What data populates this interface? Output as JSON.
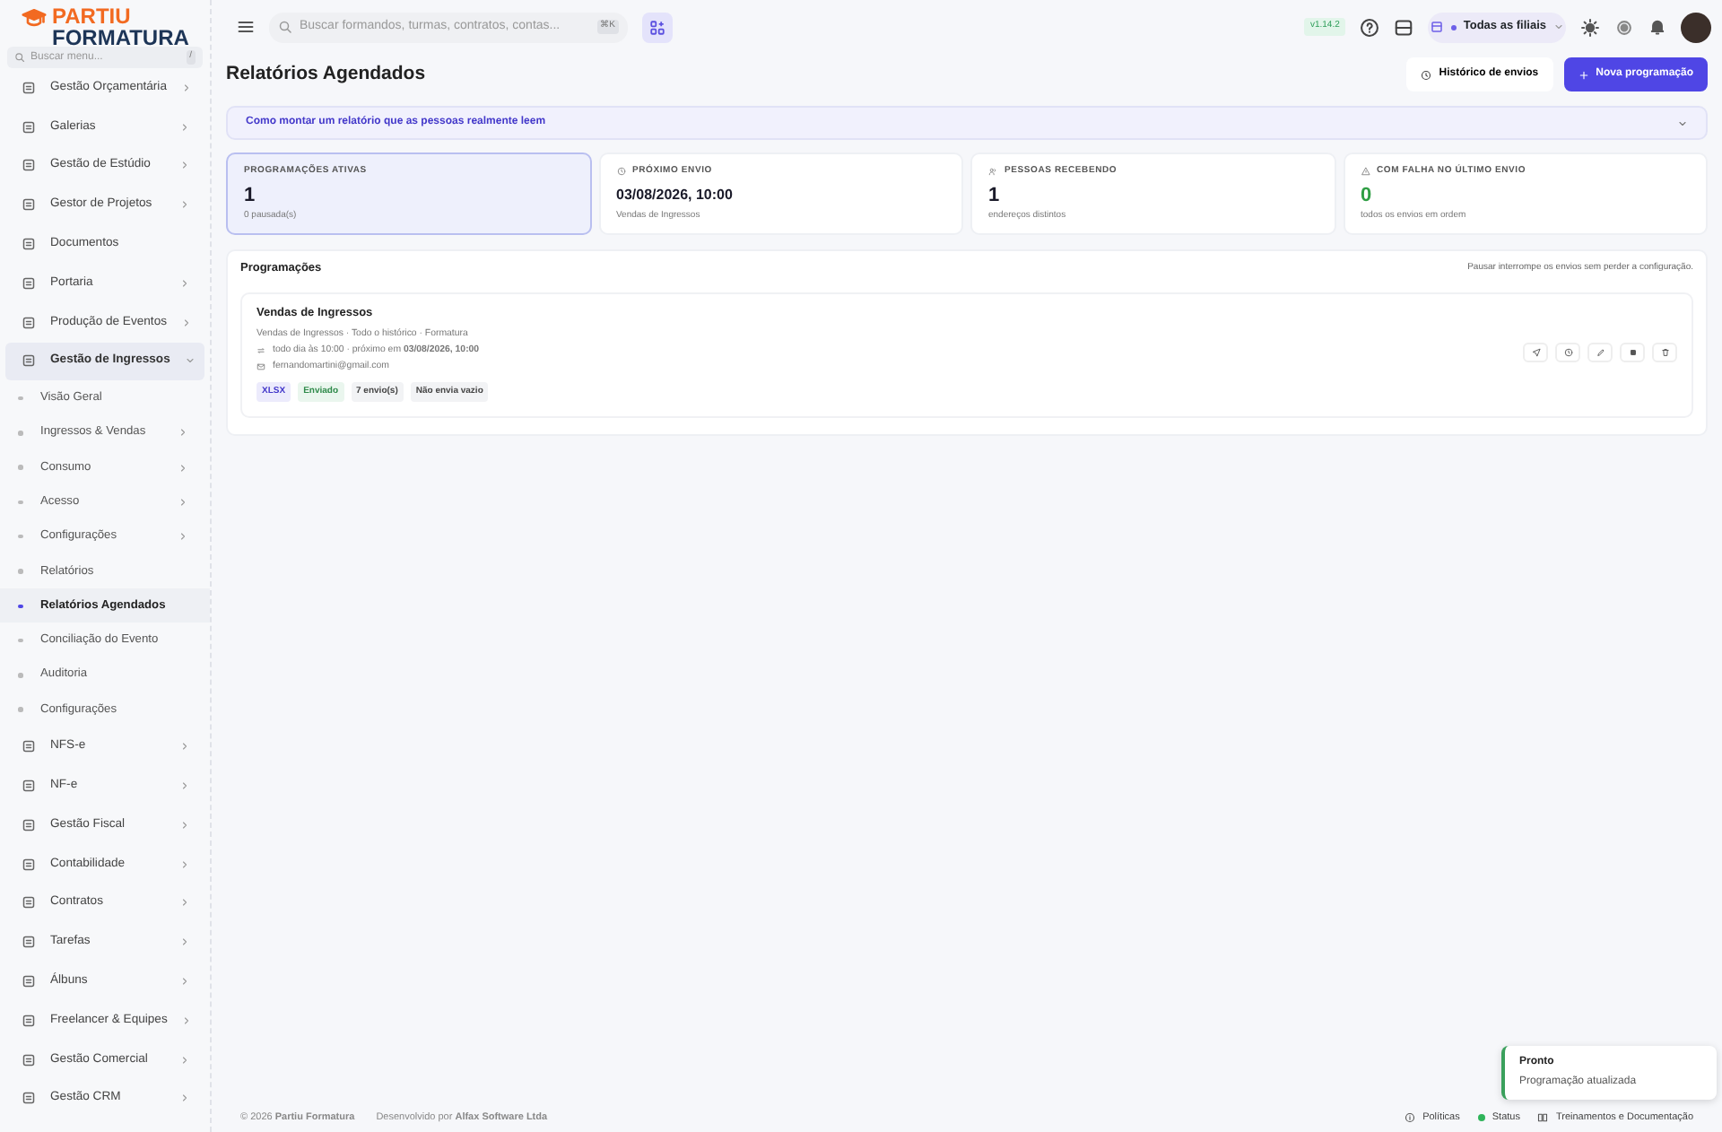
{
  "brand": {
    "line_1": "PARTIU",
    "line_2": "FORMATURA"
  },
  "sidebar": {
    "search_placeholder": "Buscar menu...",
    "search_shortcut": "/",
    "items": [
      {
        "label": "Gestão Orçamentária",
        "expandable": true,
        "expanded": false
      },
      {
        "label": "Galerias",
        "expandable": true,
        "expanded": false
      },
      {
        "label": "Gestão de Estúdio",
        "expandable": true,
        "expanded": false
      },
      {
        "label": "Gestor de Projetos",
        "expandable": true,
        "expanded": false
      },
      {
        "label": "Documentos",
        "expandable": false,
        "expanded": false
      },
      {
        "label": "Portaria",
        "expandable": true,
        "expanded": false
      },
      {
        "label": "Produção de Eventos",
        "expandable": true,
        "expanded": false
      },
      {
        "label": "Gestão de Ingressos",
        "expandable": true,
        "expanded": true,
        "children": [
          {
            "label": "Visão Geral",
            "expandable": false,
            "selected": false
          },
          {
            "label": "Ingressos & Vendas",
            "expandable": true,
            "selected": false
          },
          {
            "label": "Consumo",
            "expandable": true,
            "selected": false
          },
          {
            "label": "Acesso",
            "expandable": true,
            "selected": false
          },
          {
            "label": "Configurações",
            "expandable": true,
            "selected": false
          },
          {
            "label": "Relatórios",
            "expandable": false,
            "selected": false
          },
          {
            "label": "Relatórios Agendados",
            "expandable": false,
            "selected": true
          },
          {
            "label": "Conciliação do Evento",
            "expandable": false,
            "selected": false
          },
          {
            "label": "Auditoria",
            "expandable": false,
            "selected": false
          },
          {
            "label": "Configurações",
            "expandable": false,
            "selected": false
          }
        ]
      },
      {
        "label": "NFS-e",
        "expandable": true,
        "expanded": false
      },
      {
        "label": "NF-e",
        "expandable": true,
        "expanded": false
      },
      {
        "label": "Gestão Fiscal",
        "expandable": true,
        "expanded": false
      },
      {
        "label": "Contabilidade",
        "expandable": true,
        "expanded": false
      },
      {
        "label": "Contratos",
        "expandable": true,
        "expanded": false
      },
      {
        "label": "Tarefas",
        "expandable": true,
        "expanded": false
      },
      {
        "label": "Álbuns",
        "expandable": true,
        "expanded": false
      },
      {
        "label": "Freelancer & Equipes",
        "expandable": true,
        "expanded": false
      },
      {
        "label": "Gestão Comercial",
        "expandable": true,
        "expanded": false
      },
      {
        "label": "Gestão CRM",
        "expandable": true,
        "expanded": false
      }
    ]
  },
  "topbar": {
    "search_placeholder": "Buscar formandos, turmas, contratos, contas...",
    "search_shortcut": "⌘K",
    "version": "v1.14.2",
    "branch_selector": "Todas as filiais"
  },
  "page": {
    "title": "Relatórios Agendados",
    "buttons": [
      {
        "label": "Histórico de envios",
        "kind": "secondary"
      },
      {
        "label": "Nova programação",
        "kind": "primary"
      }
    ],
    "tip": {
      "text": "Como montar um relatório que as pessoas realmente leem",
      "expanded": false
    }
  },
  "stats": [
    {
      "label": "PROGRAMAÇÕES ATIVAS",
      "value": "1",
      "note": "0 pausada(s)",
      "selected": true,
      "kind": "plain"
    },
    {
      "label": "PRÓXIMO ENVIO",
      "value": "03/08/2026, 10:00",
      "note": "Vendas de Ingressos",
      "selected": false,
      "kind": "plain"
    },
    {
      "label": "PESSOAS RECEBENDO",
      "value": "1",
      "note": "endereços distintos",
      "selected": false,
      "kind": "plain"
    },
    {
      "label": "COM FALHA NO ÚLTIMO ENVIO",
      "value": "0",
      "note": "todos os envios em ordem",
      "selected": false,
      "kind": "success"
    }
  ],
  "schedules": {
    "title": "Programações",
    "hint": "Pausar interrompe os envios sem perder a configuração.",
    "items": [
      {
        "name": "Vendas de Ingressos",
        "details": "Vendas de Ingressos · Todo o histórico · Formatura",
        "recurrence": "todo dia às 10:00 · próximo em **03/08/2026, 10:00**",
        "email": "fernandomartini@gmail.com",
        "tags": [
          {
            "label": "XLSX",
            "kind": "format"
          },
          {
            "label": "Enviado",
            "kind": "success"
          },
          {
            "label": "7 envio(s)",
            "kind": "neutral"
          },
          {
            "label": "Não envia vazio",
            "kind": "neutral"
          }
        ]
      }
    ]
  },
  "footer": {
    "copyright": "© 2026 **Partiu Formatura**",
    "credit": "Desenvolvido por **Alfax Software Ltda**",
    "links": [
      {
        "label": "Políticas",
        "kind": "policy"
      },
      {
        "label": "Status",
        "kind": "status"
      },
      {
        "label": "Treinamentos e Documentação",
        "kind": "docs"
      }
    ]
  },
  "toast": {
    "title": "Pronto",
    "message": "Programação atualizada"
  }
}
